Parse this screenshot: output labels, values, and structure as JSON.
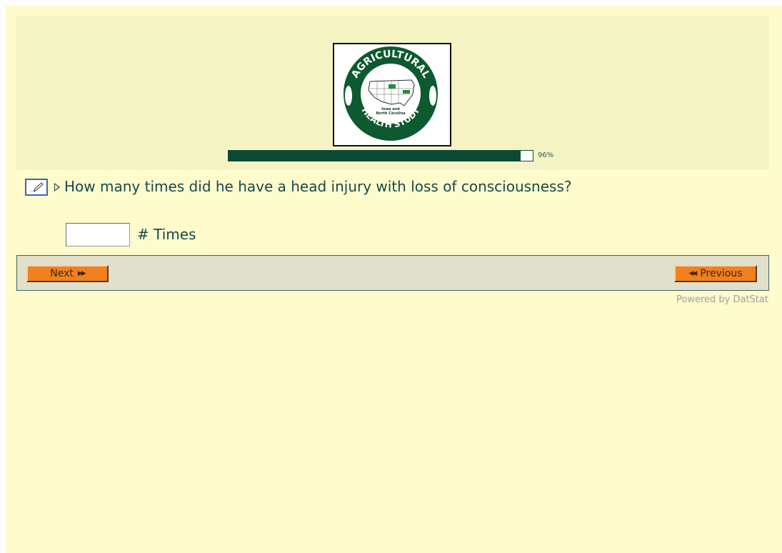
{
  "logo": {
    "alt": "Agricultural Health Study logo",
    "top_text": "AGRICULTURAL",
    "bottom_text": "HEALTH STUDY",
    "inner_text_line1": "Iowa and",
    "inner_text_line2": "North Carolina"
  },
  "progress": {
    "percent": 96,
    "label": "96%"
  },
  "question": {
    "edit_icon": "pencil-edit-icon",
    "arrow_icon": "triangle-right-icon",
    "text": "How many times did he have a head injury with loss of consciousness?"
  },
  "answer": {
    "value": "",
    "unit_label": "# Times"
  },
  "nav": {
    "next_label": "Next",
    "previous_label": "Previous"
  },
  "footer": {
    "powered_by": "Powered by DatStat"
  },
  "colors": {
    "page_bg": "#fefbcd",
    "header_bg": "#f3f3c4",
    "progress_fill": "#0b4a35",
    "button_orange": "#f08020",
    "text_teal": "#164a4a"
  }
}
